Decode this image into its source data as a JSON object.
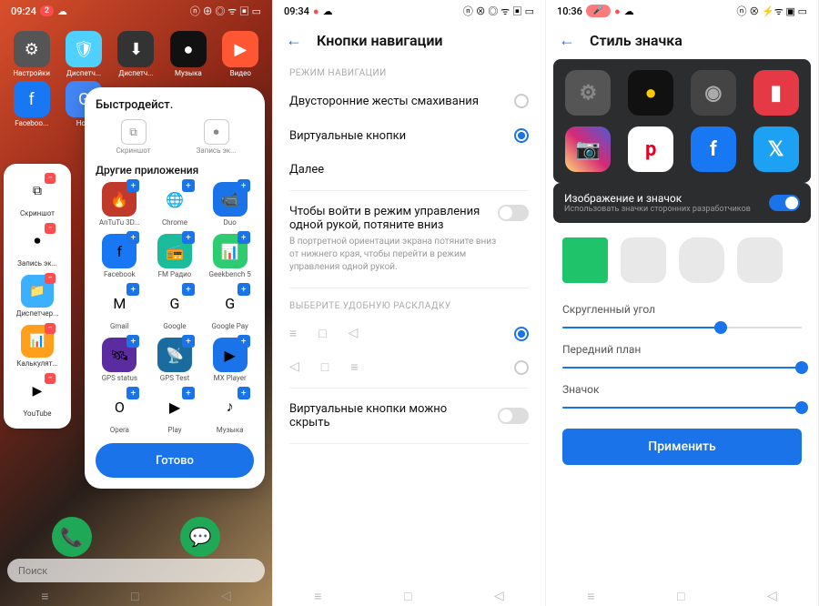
{
  "p1": {
    "time": "09:24",
    "notif": "2",
    "home": [
      {
        "l": "Настройки",
        "c": "#555",
        "g": "⚙"
      },
      {
        "l": "Диспетч...",
        "c": "#4fd1ff",
        "g": "🛡"
      },
      {
        "l": "Диспетч...",
        "c": "#333",
        "g": "⬇"
      },
      {
        "l": "Музыка",
        "c": "#111",
        "g": "●"
      },
      {
        "l": "Видео",
        "c": "#ff5733",
        "g": "▶"
      },
      {
        "l": "Faceboo...",
        "c": "#1877f2",
        "g": "f"
      },
      {
        "l": "Ho...",
        "c": "#4285f4",
        "g": "G"
      }
    ],
    "side": [
      {
        "l": "Скриншот",
        "c": "#fff",
        "g": "⧉"
      },
      {
        "l": "Запись эк...",
        "c": "#fff",
        "g": "⏺"
      },
      {
        "l": "Диспетчер...",
        "c": "#3ab0ff",
        "g": "📁"
      },
      {
        "l": "Калькулят...",
        "c": "#ff9f1c",
        "g": "📊"
      },
      {
        "l": "YouTube",
        "c": "#fff",
        "g": "▶"
      }
    ],
    "sheet": {
      "title": "Быстродейст.",
      "g1": "Скриншот",
      "g2": "Запись эк...",
      "sub": "Другие приложения",
      "apps": [
        {
          "l": "AnTuTu 3D...",
          "c": "#c0392b",
          "g": "🔥"
        },
        {
          "l": "Chrome",
          "c": "#fff",
          "g": "🌐"
        },
        {
          "l": "Duo",
          "c": "#1a73e8",
          "g": "📹"
        },
        {
          "l": "Facebook",
          "c": "#1877f2",
          "g": "f"
        },
        {
          "l": "FM Радио",
          "c": "#1abc9c",
          "g": "📻"
        },
        {
          "l": "Geekbench 5",
          "c": "#2ecc71",
          "g": "📊"
        },
        {
          "l": "Gmail",
          "c": "#fff",
          "g": "M"
        },
        {
          "l": "Google",
          "c": "#fff",
          "g": "G"
        },
        {
          "l": "Google Pay",
          "c": "#fff",
          "g": "G"
        },
        {
          "l": "GPS status",
          "c": "#5b2c9f",
          "g": "🛰"
        },
        {
          "l": "GPS Test",
          "c": "#1a6b9f",
          "g": "📡"
        },
        {
          "l": "MX Player",
          "c": "#1a73e8",
          "g": "▶"
        },
        {
          "l": "Opera",
          "c": "#fff",
          "g": "O"
        },
        {
          "l": "Play",
          "c": "#fff",
          "g": "▶"
        },
        {
          "l": "Музыка",
          "c": "#fff",
          "g": "♪"
        }
      ],
      "btn": "Готово"
    },
    "dock": [
      {
        "c": "#1fa855",
        "g": "📞"
      },
      {
        "c": "#1fa855",
        "g": "💬"
      }
    ],
    "search": "Поиск"
  },
  "p2": {
    "time": "09:34",
    "title": "Кнопки навигации",
    "sect1": "РЕЖИМ НАВИГАЦИИ",
    "opt1": "Двусторонние жесты смахивания",
    "opt2": "Виртуальные кнопки",
    "opt3": "Далее",
    "sub_t": "Чтобы войти в режим управления одной рукой, потяните вниз",
    "sub_d": "В портретной ориентации экрана потяните вниз от нижнего края, чтобы перейти в режим управления одной рукой.",
    "sect2": "ВЫБЕРИТЕ УДОБНУЮ РАСКЛАДКУ",
    "hide": "Виртуальные кнопки можно скрыть"
  },
  "p3": {
    "time": "10:36",
    "title": "Стиль значка",
    "sw_t": "Изображение и значок",
    "sw_d": "Использовать значки сторонних разработчиков",
    "s1": "Скругленный угол",
    "v1": 66,
    "s2": "Передний план",
    "v2": 100,
    "s3": "Значок",
    "v3": 100,
    "apply": "Применить"
  }
}
